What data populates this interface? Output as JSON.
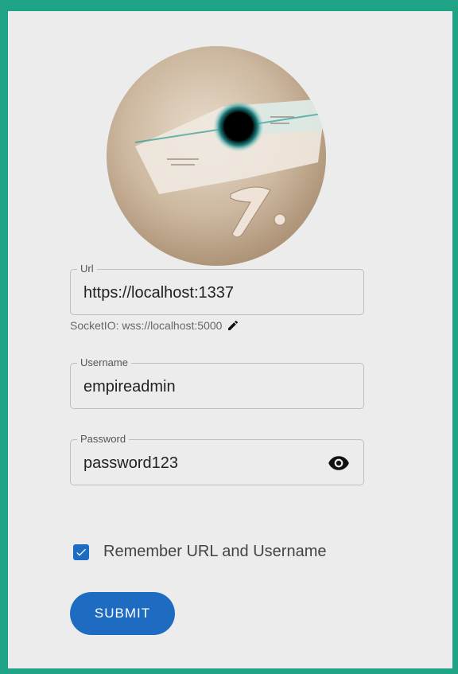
{
  "form": {
    "url": {
      "label": "Url",
      "value": "https://localhost:1337",
      "hint": "SocketIO: wss://localhost:5000"
    },
    "username": {
      "label": "Username",
      "value": "empireadmin"
    },
    "password": {
      "label": "Password",
      "value": "password123"
    },
    "remember": {
      "label": "Remember URL and Username",
      "checked": true
    },
    "submit_label": "SUBMIT"
  },
  "icons": {
    "edit": "pencil-icon",
    "reveal": "eye-icon",
    "check": "check-icon"
  },
  "colors": {
    "frame": "#1fa386",
    "panel": "#ececec",
    "accent": "#1e6bc2"
  }
}
